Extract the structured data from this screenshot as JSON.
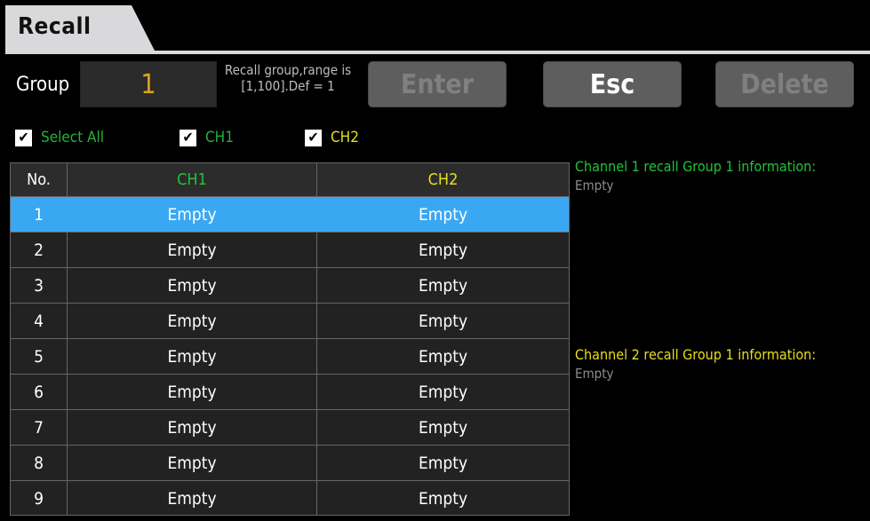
{
  "title": "Recall",
  "group": {
    "label": "Group",
    "value": "1",
    "hint_line1": "Recall group,range is",
    "hint_line2": "[1,100].Def = 1"
  },
  "buttons": {
    "enter": "Enter",
    "esc": "Esc",
    "delete": "Delete"
  },
  "checkboxes": {
    "select_all": "Select All",
    "ch1": "CH1",
    "ch2": "CH2"
  },
  "table": {
    "headers": [
      "No.",
      "CH1",
      "CH2"
    ],
    "rows": [
      {
        "no": "1",
        "ch1": "Empty",
        "ch2": "Empty"
      },
      {
        "no": "2",
        "ch1": "Empty",
        "ch2": "Empty"
      },
      {
        "no": "3",
        "ch1": "Empty",
        "ch2": "Empty"
      },
      {
        "no": "4",
        "ch1": "Empty",
        "ch2": "Empty"
      },
      {
        "no": "5",
        "ch1": "Empty",
        "ch2": "Empty"
      },
      {
        "no": "6",
        "ch1": "Empty",
        "ch2": "Empty"
      },
      {
        "no": "7",
        "ch1": "Empty",
        "ch2": "Empty"
      },
      {
        "no": "8",
        "ch1": "Empty",
        "ch2": "Empty"
      },
      {
        "no": "9",
        "ch1": "Empty",
        "ch2": "Empty"
      }
    ]
  },
  "info": {
    "ch1_title": "Channel 1 recall Group  1 information:",
    "ch1_body": "Empty",
    "ch2_title": "Channel 2 recall Group  1 information:",
    "ch2_body": "Empty"
  },
  "colors": {
    "ch1": "#22c338",
    "ch2": "#e8dd1c",
    "selected_row": "#3aa7f2",
    "group_value": "#e0a21a"
  }
}
